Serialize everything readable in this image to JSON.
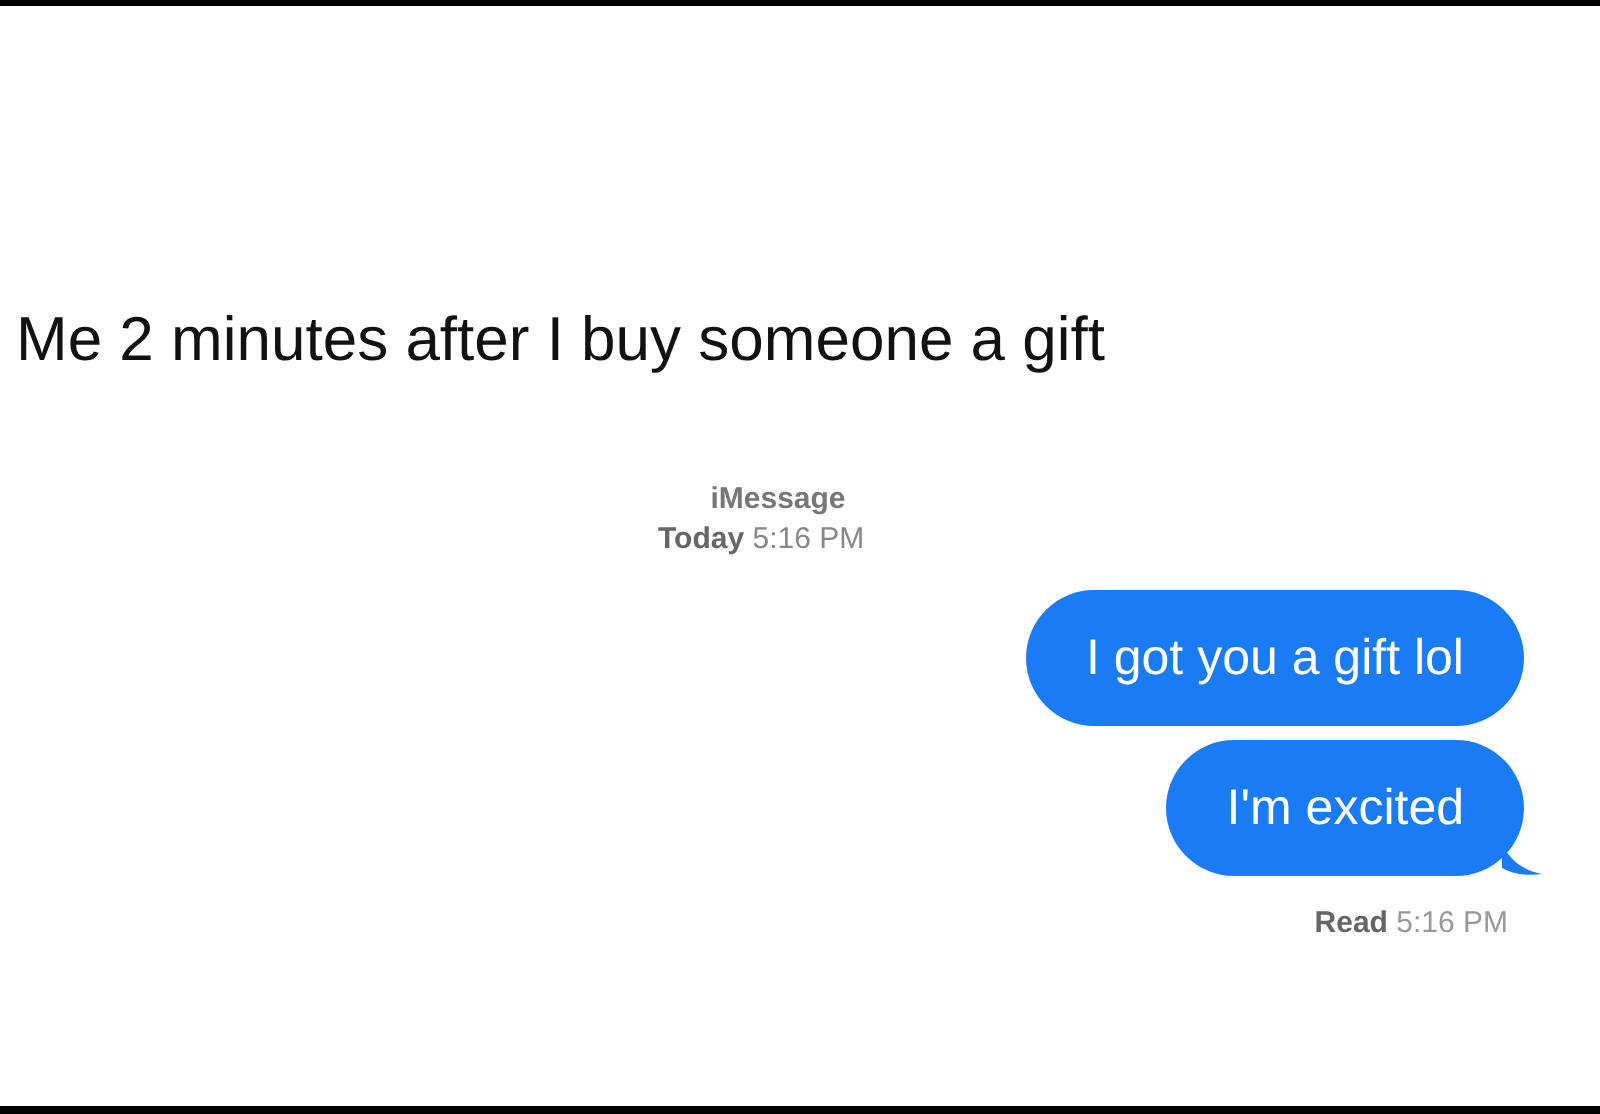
{
  "caption": "Me 2 minutes after I buy someone a gift",
  "conversation": {
    "service": "iMessage",
    "timestamp": "**Today** 5:16 PM",
    "messages": [
      {
        "text": "I got you a gift lol",
        "tail": false
      },
      {
        "text": "I'm excited",
        "tail": true
      }
    ],
    "receipt": "**Read** 5:16 PM"
  }
}
